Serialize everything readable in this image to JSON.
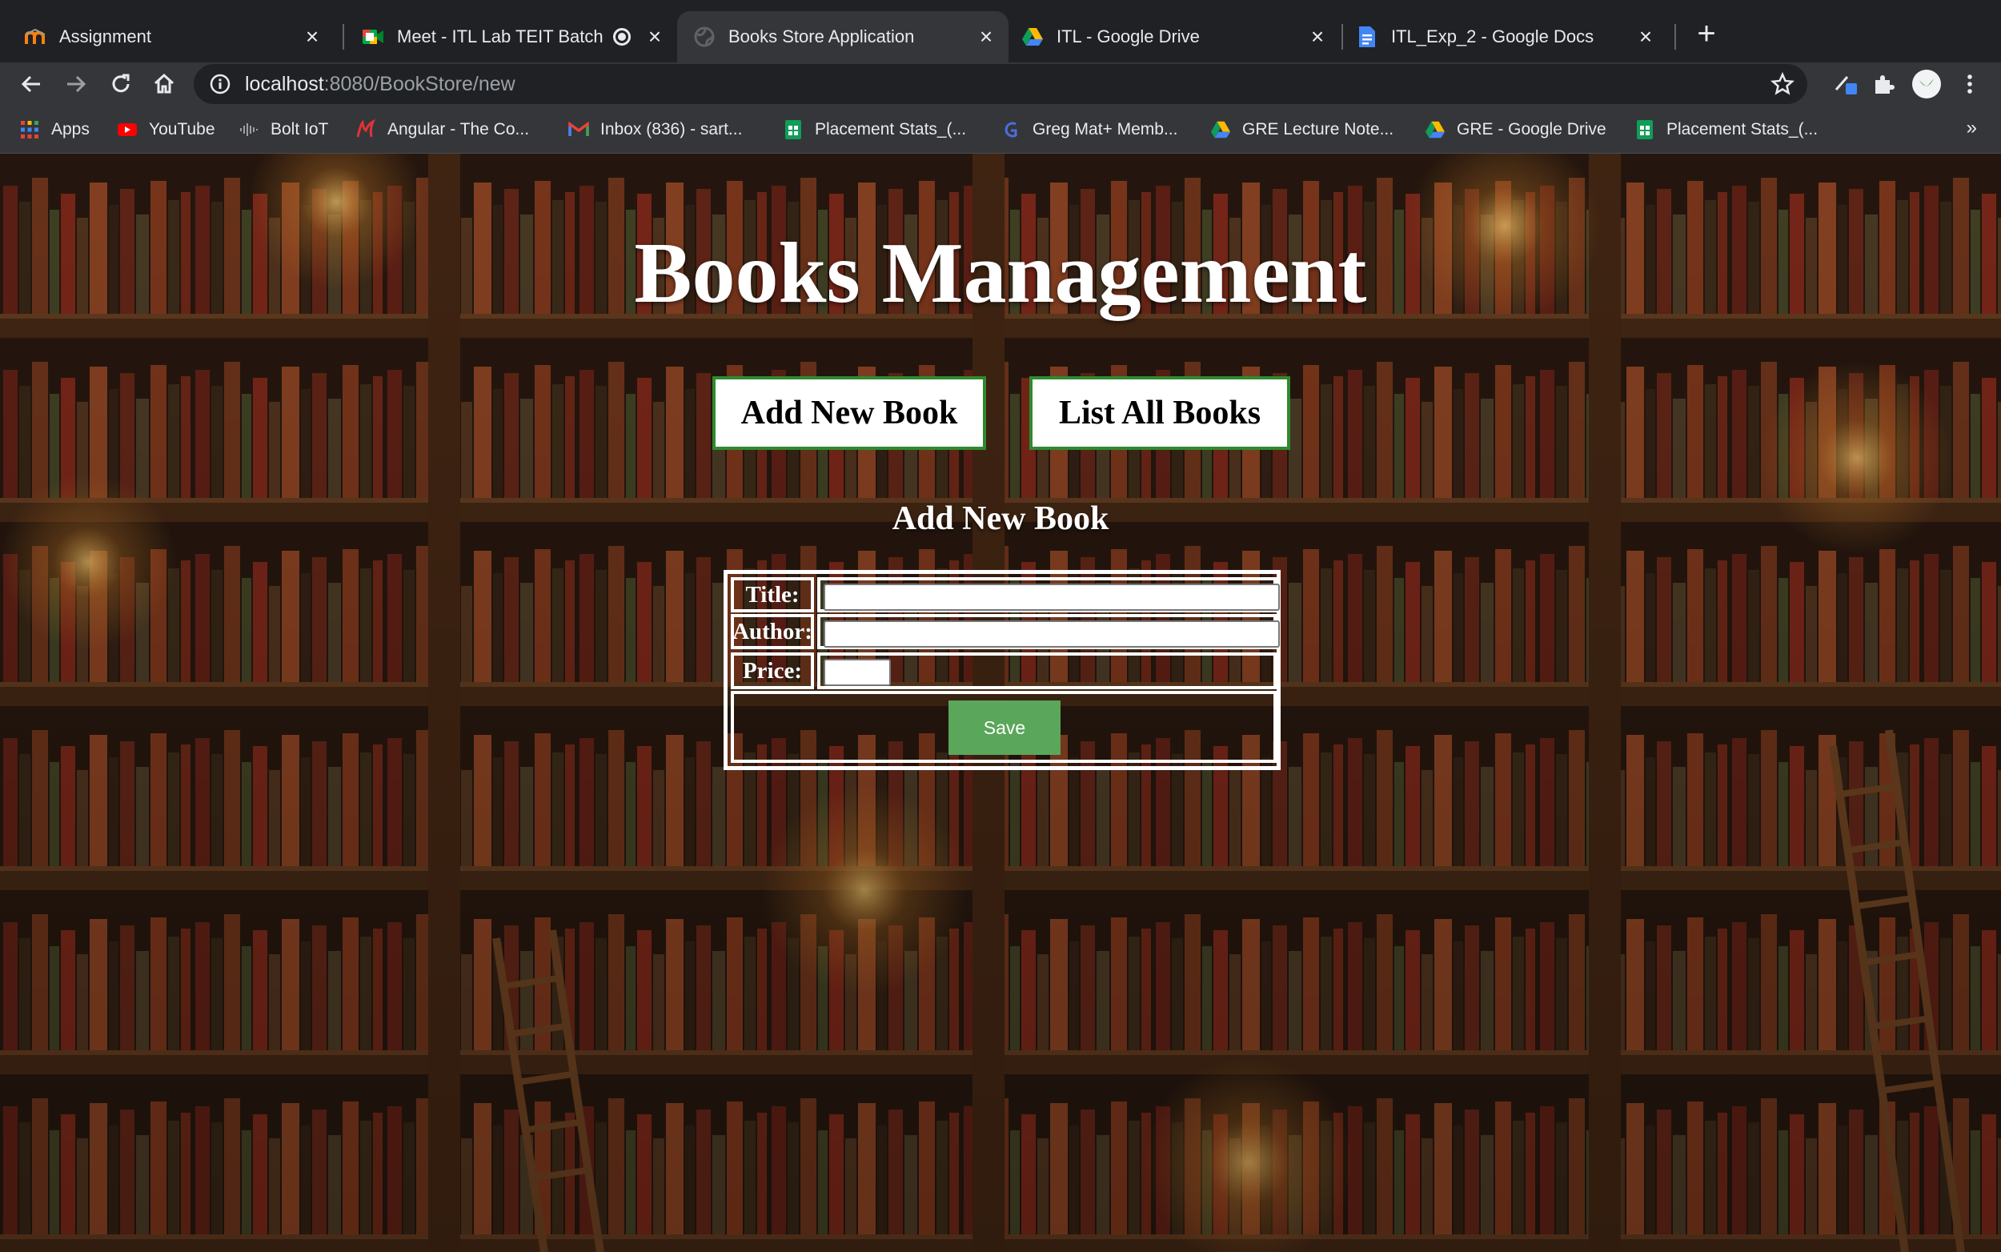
{
  "tabs": [
    {
      "title": "Assignment",
      "icon": "moodle-icon",
      "active": false
    },
    {
      "title": "Meet - ITL Lab TEIT Batch",
      "icon": "google-meet-icon",
      "active": false
    },
    {
      "title": "Books Store Application",
      "icon": "globe-icon",
      "active": true
    },
    {
      "title": "ITL - Google Drive",
      "icon": "google-drive-icon",
      "active": false
    },
    {
      "title": "ITL_Exp_2 - Google Docs",
      "icon": "google-docs-icon",
      "active": false
    }
  ],
  "address_bar": {
    "host": "localhost",
    "path": ":8080/BookStore/new"
  },
  "bookmarks": [
    {
      "label": "Apps",
      "icon": "apps-grid-icon"
    },
    {
      "label": "YouTube",
      "icon": "youtube-icon"
    },
    {
      "label": "Bolt IoT",
      "icon": "bolt-iot-icon"
    },
    {
      "label": "Angular - The Co...",
      "icon": "angular-icon"
    },
    {
      "label": "Inbox (836) - sart...",
      "icon": "gmail-icon"
    },
    {
      "label": "Placement Stats_(...",
      "icon": "google-sheets-icon"
    },
    {
      "label": "Greg Mat+ Memb...",
      "icon": "greg-mat-icon"
    },
    {
      "label": "GRE Lecture Note...",
      "icon": "google-drive-icon"
    },
    {
      "label": "GRE - Google Drive",
      "icon": "google-drive-icon"
    },
    {
      "label": "Placement Stats_(...",
      "icon": "google-sheets-icon"
    }
  ],
  "bookmarks_more": "»",
  "page": {
    "heading": "Books Management",
    "nav": {
      "add_label": "Add New Book",
      "list_label": "List All Books"
    },
    "form": {
      "caption": "Add New Book",
      "title_label": "Title:",
      "author_label": "Author:",
      "price_label": "Price:",
      "title_value": "",
      "author_value": "",
      "price_value": "",
      "save_label": "Save"
    }
  },
  "colors": {
    "accent_green": "#5aa65a",
    "button_border": "#2f8a2f",
    "tab_bar": "#202124",
    "toolbar": "#35363a"
  }
}
